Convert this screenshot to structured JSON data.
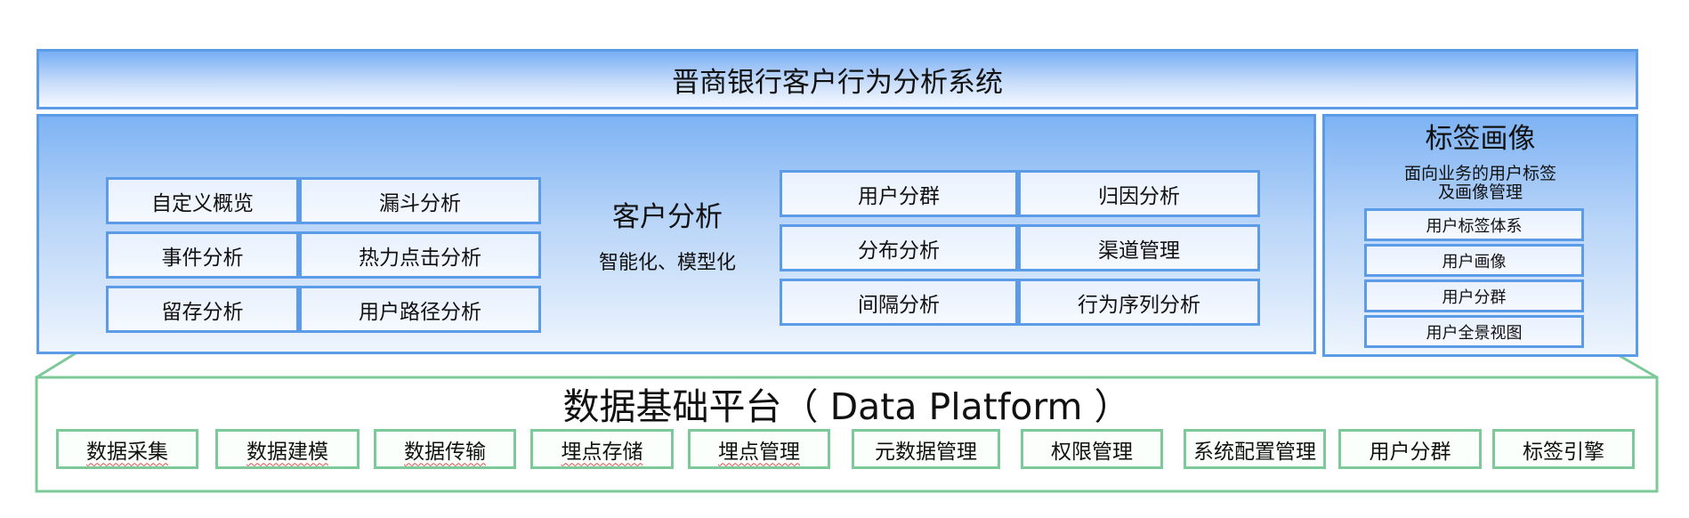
{
  "title": "晋商银行客户行为分析系统",
  "customer_analysis": {
    "heading": "客户分析",
    "subheading": "智能化、模型化",
    "left_grid": [
      "自定义概览",
      "漏斗分析",
      "事件分析",
      "热力点击分析",
      "留存分析",
      "用户路径分析"
    ],
    "right_grid": [
      "用户分群",
      "归因分析",
      "分布分析",
      "渠道管理",
      "间隔分析",
      "行为序列分析"
    ]
  },
  "tag_portrait": {
    "heading": "标签画像",
    "subheading_line1": "面向业务的用户标签",
    "subheading_line2": "及画像管理",
    "items": [
      "用户标签体系",
      "用户画像",
      "用户分群",
      "用户全景视图"
    ]
  },
  "data_platform": {
    "heading": "数据基础平台（ Data Platform ）",
    "modules": [
      "数据采集",
      "数据建模",
      "数据传输",
      "埋点存储",
      "埋点管理",
      "元数据管理",
      "权限管理",
      "系统配置管理",
      "用户分群",
      "标签引擎"
    ]
  },
  "colors": {
    "blue_border": "#5b9be8",
    "green_border": "#7ec99a"
  }
}
